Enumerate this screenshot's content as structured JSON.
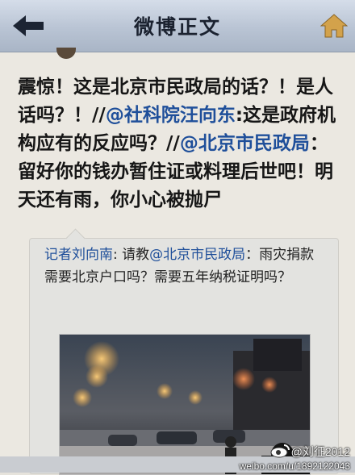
{
  "header": {
    "title": "微博正文",
    "back_icon": "back-arrow-icon",
    "home_icon": "home-icon"
  },
  "post": {
    "segments": [
      {
        "text": "震惊！这是北京市民政局的话？！是人话吗？！//",
        "mention": false
      },
      {
        "text": "@社科院汪向东",
        "mention": true
      },
      {
        "text": ":这是政府机构应有的反应吗？//",
        "mention": false
      },
      {
        "text": "@北京市民政局",
        "mention": true
      },
      {
        "text": "：留好你的钱办暂住证或料理后世吧！明天还有雨，你小心被抛尸",
        "mention": false
      }
    ]
  },
  "retweet": {
    "author": "记者刘向南",
    "text_before_mention": ": 请教",
    "mention": "@北京市民政局",
    "text_after_mention": "：雨灾捐款需要北京户口吗？需要五年纳税证明吗？"
  },
  "watermark": {
    "name": "@刘征2012",
    "url": "weibo.com/u/1892122043",
    "logo_icon": "weibo-logo-icon"
  },
  "colors": {
    "mention": "#1f4f9a",
    "header": "#b9c4d4",
    "background": "#ebe8e1"
  }
}
